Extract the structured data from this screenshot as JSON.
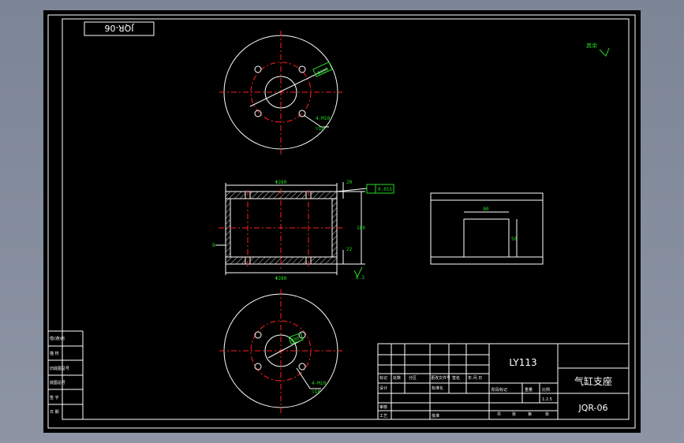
{
  "drawing": {
    "stamp": "JQR-06",
    "surface_note": "其余",
    "part_material": "LY113",
    "part_name": "气缸支座",
    "drawing_code": "JQR-06",
    "scale": "1:2.5",
    "left_block": [
      "借(通)用",
      "描 校",
      "旧底图总号",
      "底图总号",
      "签 字",
      "日 期"
    ],
    "title_headers": [
      "标记",
      "处数",
      "分区",
      "更改文件号",
      "签名",
      "年.月.日"
    ],
    "title_rows": {
      "design": "设计",
      "standard": "标准化",
      "review": "审核",
      "process": "工艺",
      "approve": "批准"
    },
    "stage_headers": [
      "阶段标记",
      "重量",
      "比例"
    ],
    "sheet_text": [
      "共",
      "张",
      "第",
      "张"
    ]
  },
  "dimensions": {
    "top_pcd": "Φ150",
    "top_holes": "4-M10",
    "top_depth": "▽18",
    "section_width_top": "Φ280",
    "section_width_bottom": "Φ280",
    "section_height": "180",
    "section_top_step": "20",
    "section_bottom_step": "22",
    "section_left_wall": "8",
    "flatness": "0.015",
    "roughness": "6.3",
    "bottom_pcd": "Φ80",
    "bottom_holes": "4-M10",
    "bottom_depth": "▽18",
    "right_width": "80",
    "right_height": "50"
  }
}
